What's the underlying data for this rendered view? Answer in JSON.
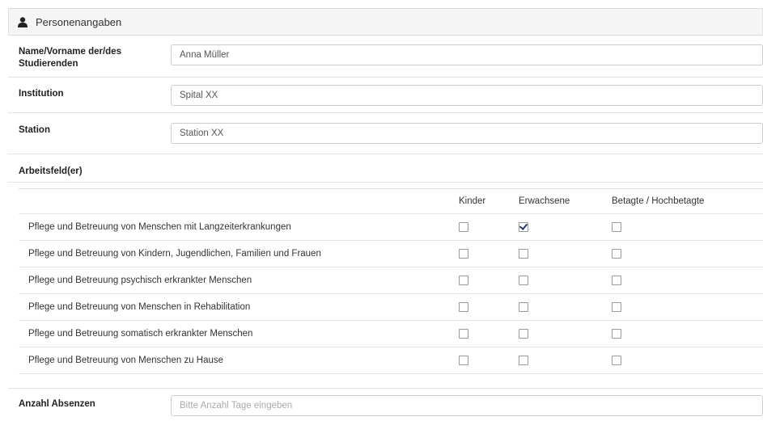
{
  "panel": {
    "title": "Personenangaben",
    "icon": "user-icon"
  },
  "fields": {
    "name": {
      "label": "Name/Vorname der/des Studierenden",
      "value": "Anna Müller"
    },
    "institution": {
      "label": "Institution",
      "value": "Spital XX"
    },
    "station": {
      "label": "Station",
      "value": "Station XX"
    }
  },
  "arbeitsfeld": {
    "label": "Arbeitsfeld(er)",
    "columns": [
      "",
      "Kinder",
      "Erwachsene",
      "Betagte / Hochbetagte"
    ],
    "rows": [
      {
        "label": "Pflege und Betreuung von Menschen mit Langzeiterkrankungen",
        "checked": [
          false,
          true,
          false
        ]
      },
      {
        "label": "Pflege und Betreuung von Kindern, Jugendlichen, Familien und Frauen",
        "checked": [
          false,
          false,
          false
        ]
      },
      {
        "label": "Pflege und Betreuung psychisch erkrankter Menschen",
        "checked": [
          false,
          false,
          false
        ]
      },
      {
        "label": "Pflege und Betreuung von Menschen in Rehabilitation",
        "checked": [
          false,
          false,
          false
        ]
      },
      {
        "label": "Pflege und Betreuung somatisch erkrankter Menschen",
        "checked": [
          false,
          false,
          false
        ]
      },
      {
        "label": "Pflege und Betreuung von Menschen zu Hause",
        "checked": [
          false,
          false,
          false
        ]
      }
    ]
  },
  "absenzen": {
    "label": "Anzahl Absenzen",
    "placeholder": "Bitte Anzahl Tage eingeben"
  },
  "colors": {
    "checkmark": "#1e3a6e",
    "header_bg": "#f5f5f5",
    "border": "#dddddd"
  }
}
